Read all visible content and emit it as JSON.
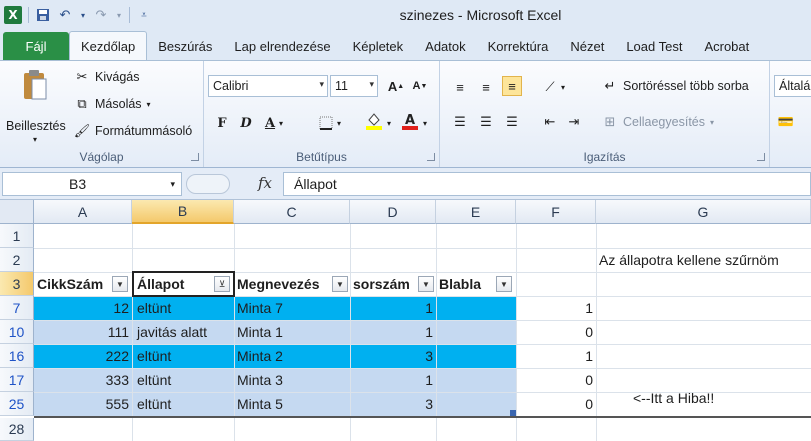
{
  "window": {
    "title": "szinezes  -  Microsoft Excel"
  },
  "qat": {
    "logo": "X"
  },
  "tabs": [
    "Fájl",
    "Kezdőlap",
    "Beszúrás",
    "Lap elrendezése",
    "Képletek",
    "Adatok",
    "Korrektúra",
    "Nézet",
    "Load Test",
    "Acrobat"
  ],
  "ribbon": {
    "clipboard": {
      "paste": "Beillesztés",
      "cut": "Kivágás",
      "copy": "Másolás",
      "format_painter": "Formátummásoló",
      "label": "Vágólap"
    },
    "font": {
      "name": "Calibri",
      "size": "11",
      "label": "Betűtípus",
      "bold": "F",
      "italic": "D",
      "underline": "A"
    },
    "alignment": {
      "wrap": "Sortöréssel több sorba",
      "merge": "Cellaegyesítés",
      "label": "Igazítás"
    },
    "number": {
      "format": "Általán"
    }
  },
  "formula_bar": {
    "name_box": "B3",
    "fx": "fx",
    "content": "Állapot"
  },
  "columns": [
    "A",
    "B",
    "C",
    "D",
    "E",
    "F",
    "G"
  ],
  "rows": [
    {
      "n": "1",
      "cells": [
        "",
        "",
        "",
        "",
        "",
        "",
        ""
      ]
    },
    {
      "n": "2",
      "cells": [
        "",
        "",
        "",
        "",
        "",
        "",
        "Az állapotra kellene szűrnöm"
      ]
    },
    {
      "n": "3",
      "cells": [
        "CikkSzám",
        "Állapot",
        "Megnevezés",
        "sorszám",
        "Blabla",
        "",
        ""
      ]
    },
    {
      "n": "7",
      "cells": [
        "12",
        "eltünt",
        "Minta 7",
        "1",
        "",
        "1",
        ""
      ]
    },
    {
      "n": "10",
      "cells": [
        "111",
        "javitás alatt",
        "Minta 1",
        "1",
        "",
        "0",
        ""
      ]
    },
    {
      "n": "16",
      "cells": [
        "222",
        "eltünt",
        "Minta 2",
        "3",
        "",
        "1",
        ""
      ]
    },
    {
      "n": "17",
      "cells": [
        "333",
        "eltünt",
        "Minta 3",
        "1",
        "",
        "0",
        ""
      ]
    },
    {
      "n": "25",
      "cells": [
        "555",
        "eltünt",
        "Minta 5",
        "3",
        "",
        "0",
        "<--Itt a Hiba!!"
      ]
    },
    {
      "n": "28",
      "cells": [
        "",
        "",
        "",
        "",
        "",
        "",
        ""
      ]
    }
  ],
  "colors": {
    "band_dark": "#00b0f0",
    "band_light": "#c5d9f1",
    "accent_green": "#2a8f46",
    "selection": "#f4c96c"
  }
}
